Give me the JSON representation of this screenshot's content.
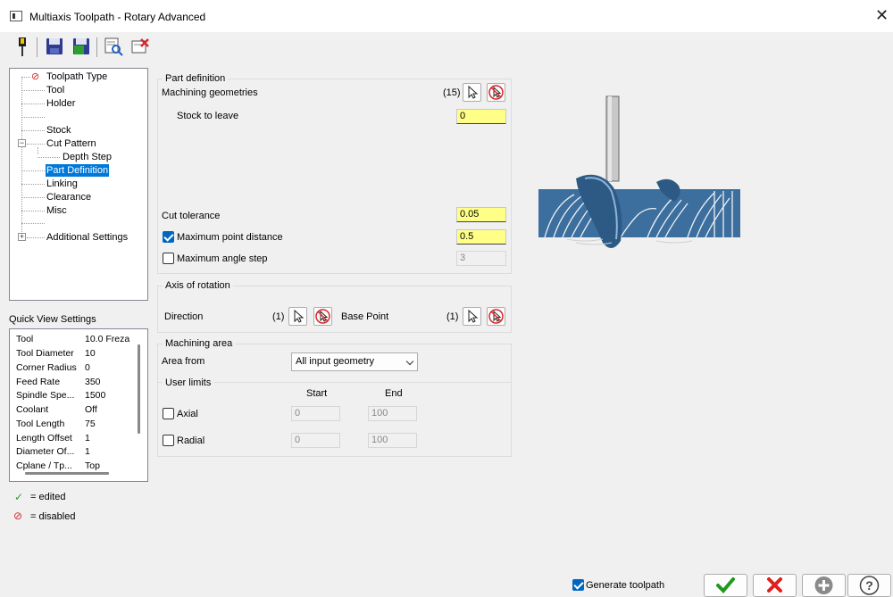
{
  "window": {
    "title": "Multiaxis Toolpath - Rotary Advanced",
    "close_glyph": "✕"
  },
  "toolbar": {
    "icons": [
      "tool-lamp-icon",
      "save-icon",
      "save-green-icon",
      "preview-icon",
      "delete-icon"
    ]
  },
  "tree": {
    "items": [
      {
        "label": "Toolpath Type",
        "status": "disabled"
      },
      {
        "label": "Tool"
      },
      {
        "label": "Holder"
      },
      {
        "label": ""
      },
      {
        "label": "Stock"
      },
      {
        "label": "Cut Pattern"
      },
      {
        "label": "Depth Step"
      },
      {
        "label": "Part Definition",
        "selected": true
      },
      {
        "label": "Linking"
      },
      {
        "label": "Clearance"
      },
      {
        "label": "Misc"
      },
      {
        "label": ""
      },
      {
        "label": "Additional Settings"
      }
    ]
  },
  "quick_view": {
    "title": "Quick View Settings",
    "rows": [
      {
        "k": "Tool",
        "v": "10.0 Freza"
      },
      {
        "k": "Tool Diameter",
        "v": "10"
      },
      {
        "k": "Corner Radius",
        "v": "0"
      },
      {
        "k": "Feed Rate",
        "v": "350"
      },
      {
        "k": "Spindle Spe...",
        "v": "1500"
      },
      {
        "k": "Coolant",
        "v": "Off"
      },
      {
        "k": "Tool Length",
        "v": "75"
      },
      {
        "k": "Length Offset",
        "v": "1"
      },
      {
        "k": "Diameter Of...",
        "v": "1"
      },
      {
        "k": "Cplane / Tp...",
        "v": "Top"
      }
    ]
  },
  "legend": {
    "edited": "= edited",
    "disabled": "= disabled",
    "edited_color": "#2e9e2e",
    "disabled_color": "#d9262b"
  },
  "part_definition": {
    "title": "Part definition",
    "machining_geometries": "Machining geometries",
    "geom_count": "(15)",
    "stock_to_leave_label": "Stock to leave",
    "stock_to_leave": "0",
    "cut_tolerance_label": "Cut tolerance",
    "cut_tolerance": "0.05",
    "max_point_distance_label": "Maximum point distance",
    "max_point_distance": "0.5",
    "max_point_distance_checked": true,
    "max_angle_step_label": "Maximum angle step",
    "max_angle_step": "3",
    "max_angle_step_checked": false
  },
  "axis_of_rotation": {
    "title": "Axis of rotation",
    "direction_label": "Direction",
    "direction_count": "(1)",
    "base_point_label": "Base Point",
    "base_point_count": "(1)"
  },
  "machining_area": {
    "title": "Machining area",
    "area_from_label": "Area from",
    "area_from": "All input geometry",
    "user_limits_title": "User limits",
    "start_header": "Start",
    "end_header": "End",
    "axial_label": "Axial",
    "axial_start": "0",
    "axial_end": "100",
    "radial_label": "Radial",
    "radial_start": "0",
    "radial_end": "100"
  },
  "footer": {
    "generate_label": "Generate toolpath",
    "generate_checked": true,
    "ok_color": "#1e9a1e",
    "cancel_color": "#e0201a"
  }
}
